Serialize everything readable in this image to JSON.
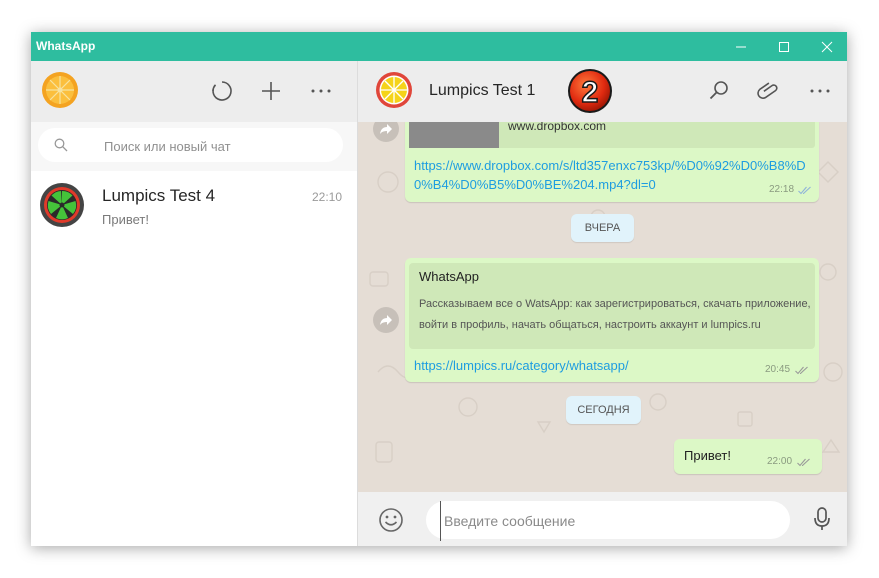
{
  "window": {
    "title": "WhatsApp",
    "accent_color": "#2ebd9f",
    "controls": [
      "minimize-icon",
      "maximize-icon",
      "close-icon"
    ]
  },
  "sidebar": {
    "header_icons": [
      "status-icon",
      "new-chat-icon",
      "menu-icon"
    ],
    "search": {
      "placeholder": "Поиск или новый чат",
      "value": ""
    },
    "chats": [
      {
        "name": "Lumpics Test 4",
        "time": "22:10",
        "preview": "Привет!"
      }
    ]
  },
  "conversation": {
    "contact_name": "Lumpics Test 1",
    "step_badge": "2",
    "header_icons": [
      "search-icon",
      "attach-icon",
      "menu-icon"
    ],
    "messages": [
      {
        "preview_domain": "www.dropbox.com",
        "link": "https://www.dropbox.com/s/ltd357enxc753kp/%D0%92%D0%B8%D0%B4%D0%B5%D0%BE%204.mp4?dl=0",
        "time": "22:18"
      },
      {
        "date_separator": "ВЧЕРА"
      },
      {
        "card_title": "WhatsApp",
        "card_description": "Рассказываем все о WatsApp: как зарегистрироваться, скачать приложение, войти в профиль, начать общаться, настроить аккаунт и lumpics.ru",
        "link": "https://lumpics.ru/category/whatsapp/",
        "time": "20:45"
      },
      {
        "date_separator": "СЕГОДНЯ"
      },
      {
        "text": "Привет!",
        "time": "22:00"
      }
    ],
    "compose": {
      "placeholder": "Введите сообщение",
      "value": ""
    }
  }
}
